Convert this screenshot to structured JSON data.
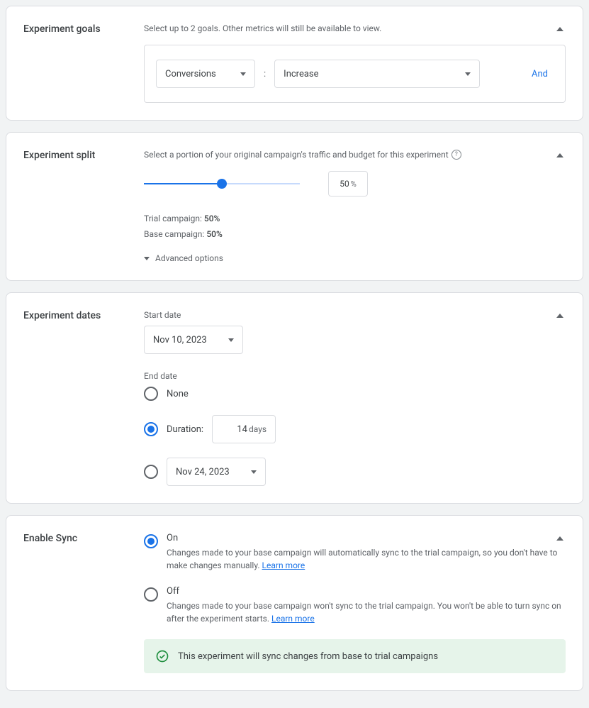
{
  "goals": {
    "title": "Experiment goals",
    "helper": "Select up to 2 goals. Other metrics will still be available to view.",
    "metric": "Conversions",
    "direction": "Increase",
    "colon": ":",
    "and_link": "And"
  },
  "split": {
    "title": "Experiment split",
    "helper": "Select a portion of your original campaign's traffic and budget for this experiment",
    "value": "50",
    "unit": "%",
    "trial_label": "Trial campaign: ",
    "trial_pct": "50%",
    "base_label": "Base campaign: ",
    "base_pct": "50%",
    "advanced": "Advanced options"
  },
  "dates": {
    "title": "Experiment dates",
    "start_label": "Start date",
    "start_date": "Nov 10, 2023",
    "end_label": "End date",
    "none_label": "None",
    "duration_label": "Duration:",
    "duration_value": "14",
    "duration_unit": "days",
    "end_date": "Nov 24, 2023"
  },
  "sync": {
    "title": "Enable Sync",
    "on_label": "On",
    "on_desc": "Changes made to your base campaign will automatically sync to the trial campaign, so you don't have to make changes manually. ",
    "off_label": "Off",
    "off_desc": "Changes made to your base campaign won't sync to the trial campaign. You won't be able to turn sync on after the experiment starts. ",
    "learn_more": "Learn more",
    "banner": "This experiment will sync changes from base to trial campaigns"
  }
}
